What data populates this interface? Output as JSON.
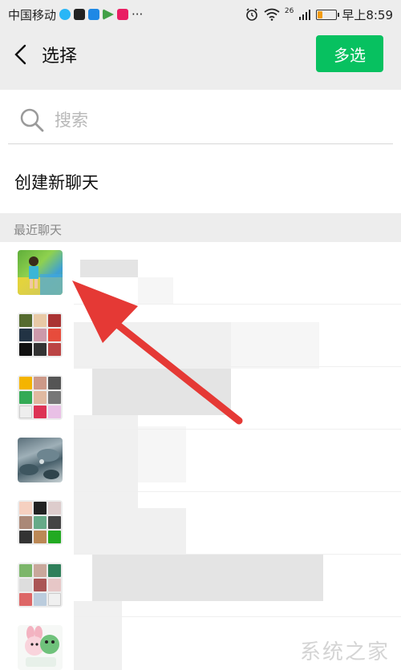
{
  "status_bar": {
    "carrier": "中国移动",
    "dots": "···",
    "network": "26",
    "time": "早上8:59",
    "battery_level": 0.25,
    "colors": {
      "app1": "#29b6f6",
      "app2": "#222222",
      "app3": "#1e88e5",
      "app4": "#43a047",
      "app5": "#e91e63"
    }
  },
  "header": {
    "title": "选择",
    "multi_select_label": "多选",
    "accent": "#07c160"
  },
  "search": {
    "placeholder": "搜索"
  },
  "create_chat_label": "创建新聊天",
  "section_title": "最近聊天",
  "chats": [
    {
      "avatar_type": "photo",
      "avatar_theme": "green-yard"
    },
    {
      "avatar_type": "group"
    },
    {
      "avatar_type": "group"
    },
    {
      "avatar_type": "photo",
      "avatar_theme": "rocks"
    },
    {
      "avatar_type": "group"
    },
    {
      "avatar_type": "group"
    },
    {
      "avatar_type": "cartoon"
    }
  ],
  "annotation_color": "#e53935",
  "watermark": "系统之家"
}
